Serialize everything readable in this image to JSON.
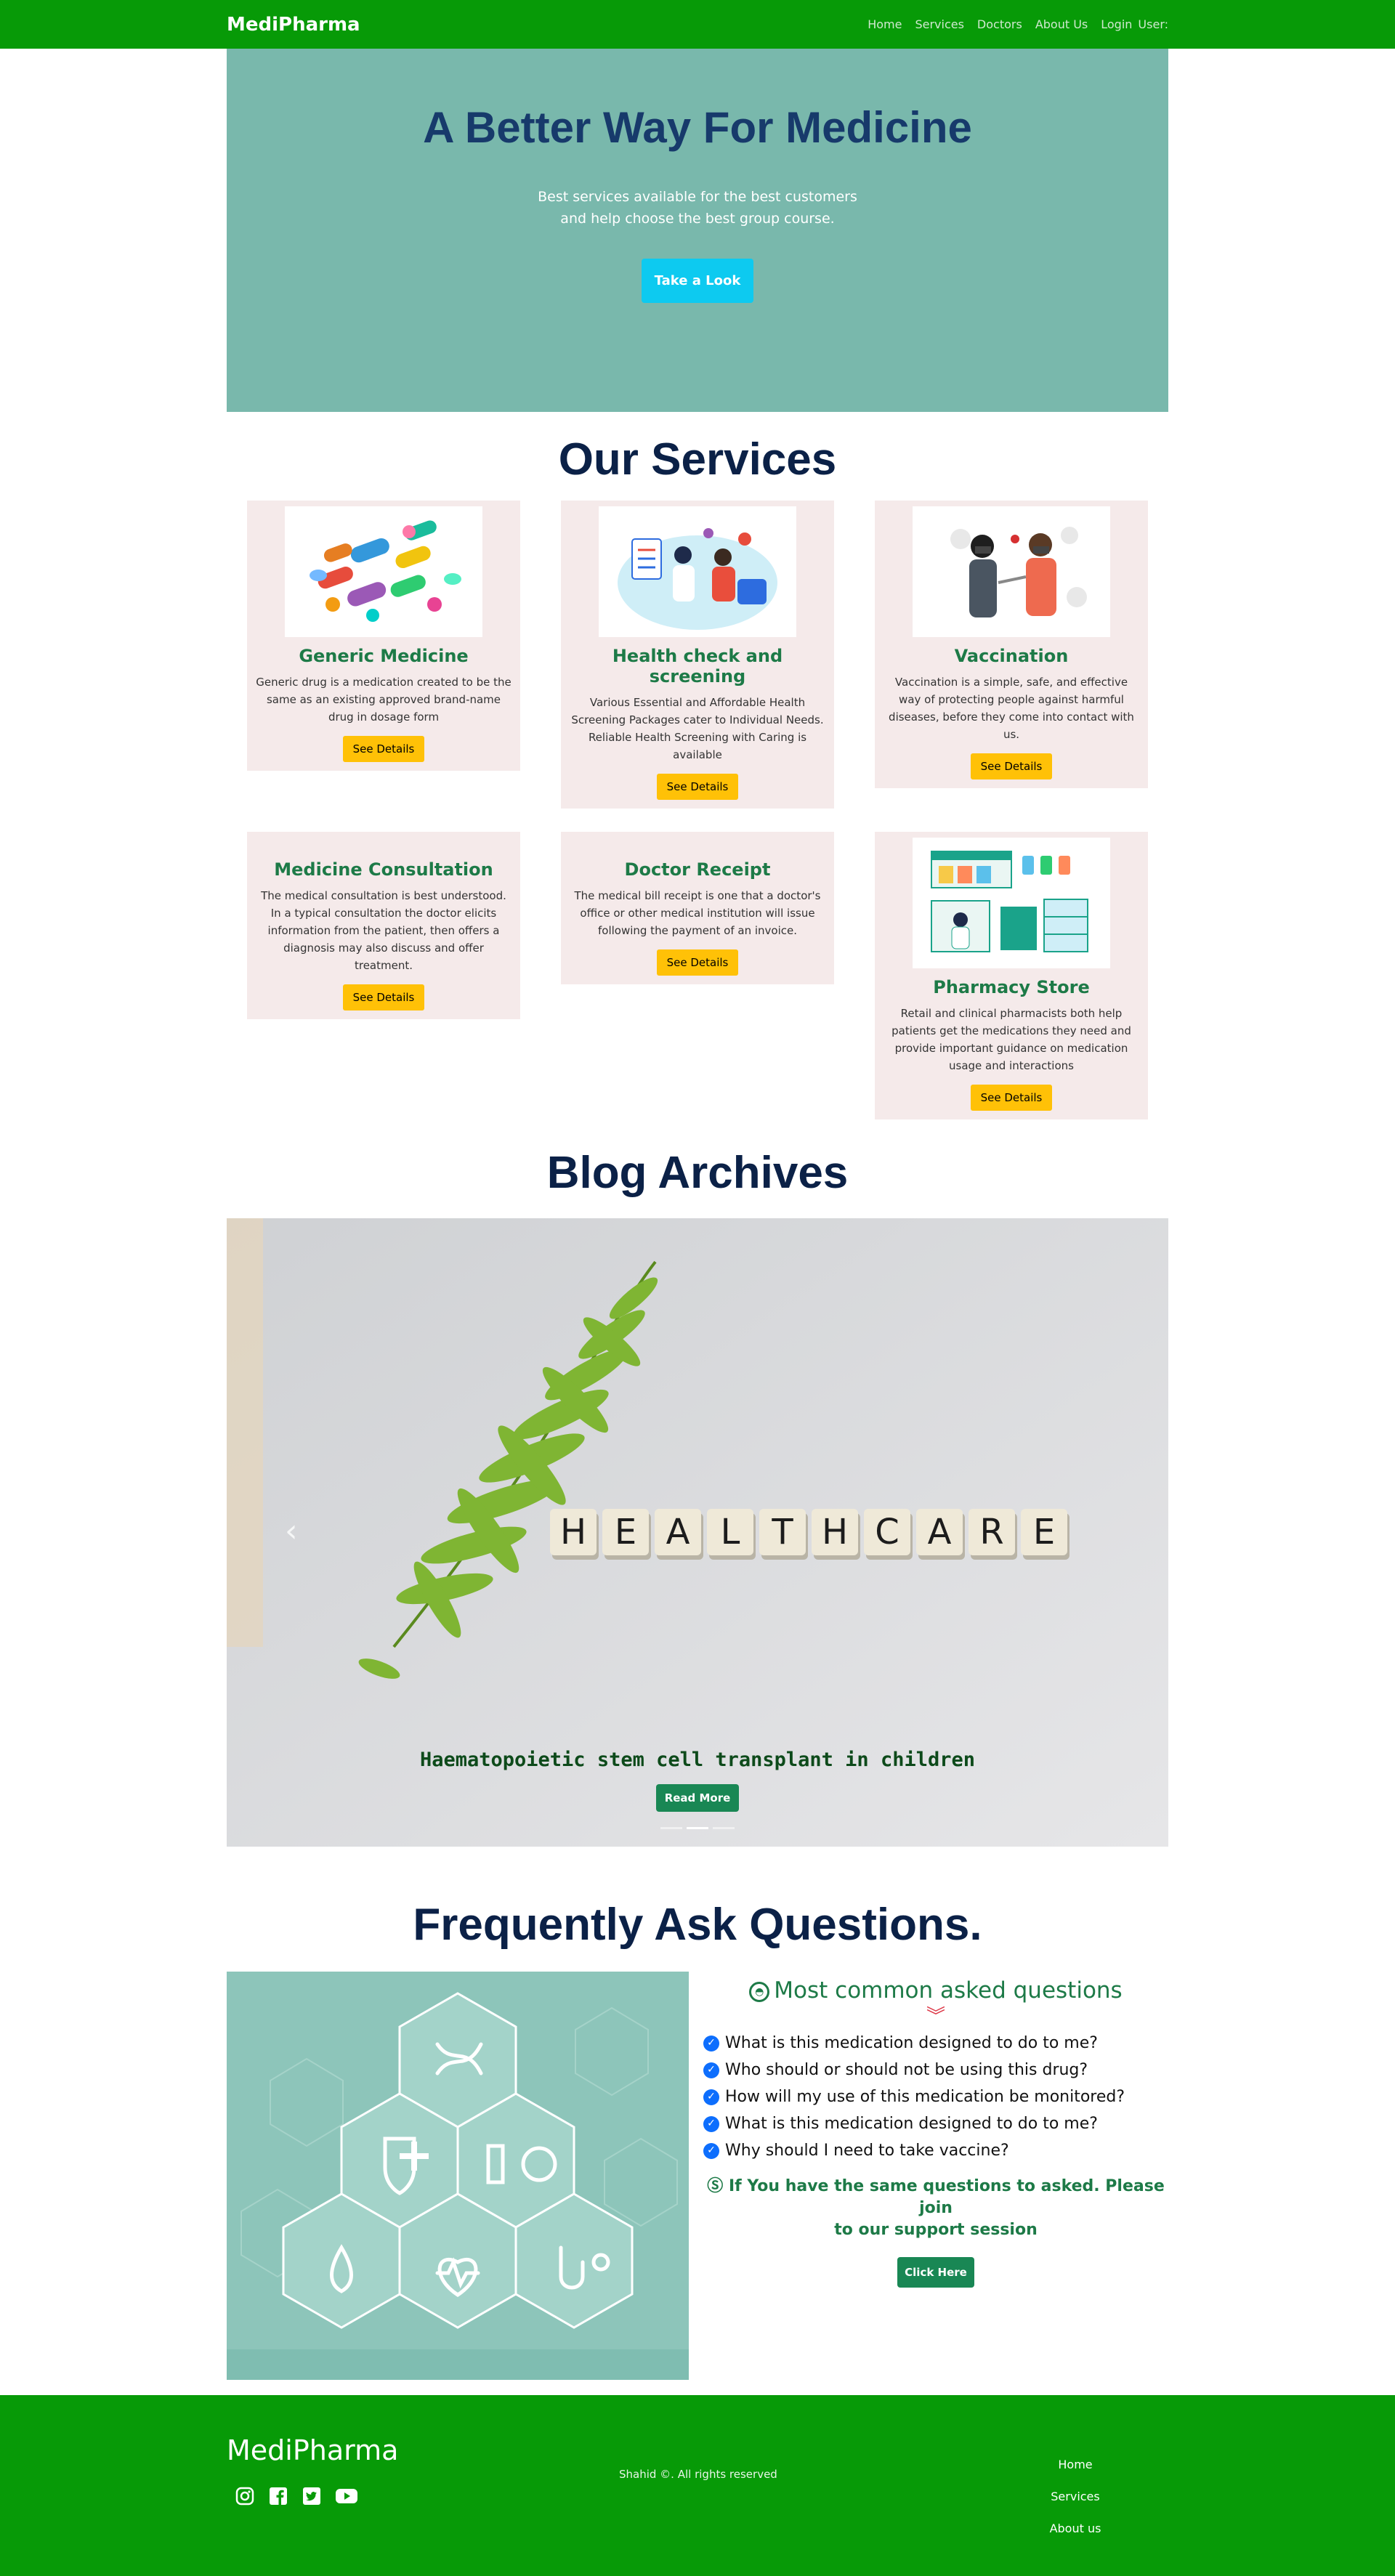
{
  "nav": {
    "brand": "MediPharma",
    "links": [
      "Home",
      "Services",
      "Doctors",
      "About Us",
      "Login",
      "User:"
    ]
  },
  "hero": {
    "title": "A Better Way For Medicine",
    "subtitle_line1": "Best services available for the best customers",
    "subtitle_line2": "and help choose the best group course.",
    "button": "Take a Look"
  },
  "services": {
    "title": "Our Services",
    "button_label": "See Details",
    "items": [
      {
        "title": "Generic Medicine",
        "text": "Generic drug is a medication created to be the same as an existing approved brand-name drug in dosage form"
      },
      {
        "title": "Health check and screening",
        "text": "Various Essential and Affordable Health Screening Packages cater to Individual Needs. Reliable Health Screening with Caring is available"
      },
      {
        "title": "Vaccination",
        "text": "Vaccination is a simple, safe, and effective way of protecting people against harmful diseases, before they come into contact with us."
      },
      {
        "title": "Medicine Consultation",
        "text": "The medical consultation is best understood. In a typical consultation the doctor elicits information from the patient, then offers a diagnosis may also discuss and offer treatment."
      },
      {
        "title": "Doctor Receipt",
        "text": "The medical bill receipt is one that a doctor's office or other medical institution will issue following the payment of an invoice."
      },
      {
        "title": "Pharmacy Store",
        "text": "Retail and clinical pharmacists both help patients get the medications they need and provide important guidance on medication usage and interactions"
      }
    ]
  },
  "blog": {
    "title": "Blog Archives",
    "slide_word": "HEALTHCARE",
    "caption": "Haematopoietic stem cell transplant in children",
    "button": "Read More"
  },
  "faq": {
    "title": "Frequently Ask Questions.",
    "heading": "Most common asked questions",
    "questions": [
      "What is this medication designed to do to me?",
      "Who should or should not be using this drug?",
      "How will my use of this medication be monitored?",
      "What is this medication designed to do to me?",
      "Why should I need to take vaccine?"
    ],
    "note_line1": "If You have the same questions to asked. Please join",
    "note_line2": "to our support session",
    "button": "Click Here"
  },
  "footer": {
    "brand": "MediPharma",
    "copyright": "Shahid ©. All rights reserved",
    "links": [
      "Home",
      "Services",
      "About us"
    ],
    "social_icons": [
      "instagram-icon",
      "facebook-icon",
      "twitter-icon",
      "youtube-icon"
    ]
  },
  "colors": {
    "nav_green": "#079a07",
    "hero_teal": "#79b8ac",
    "title_navy": "#0b2147",
    "card_bg": "#f5eaea",
    "card_title_green": "#1d7a47",
    "details_yellow": "#ffc107",
    "cta_cyan": "#0dcaf0"
  }
}
